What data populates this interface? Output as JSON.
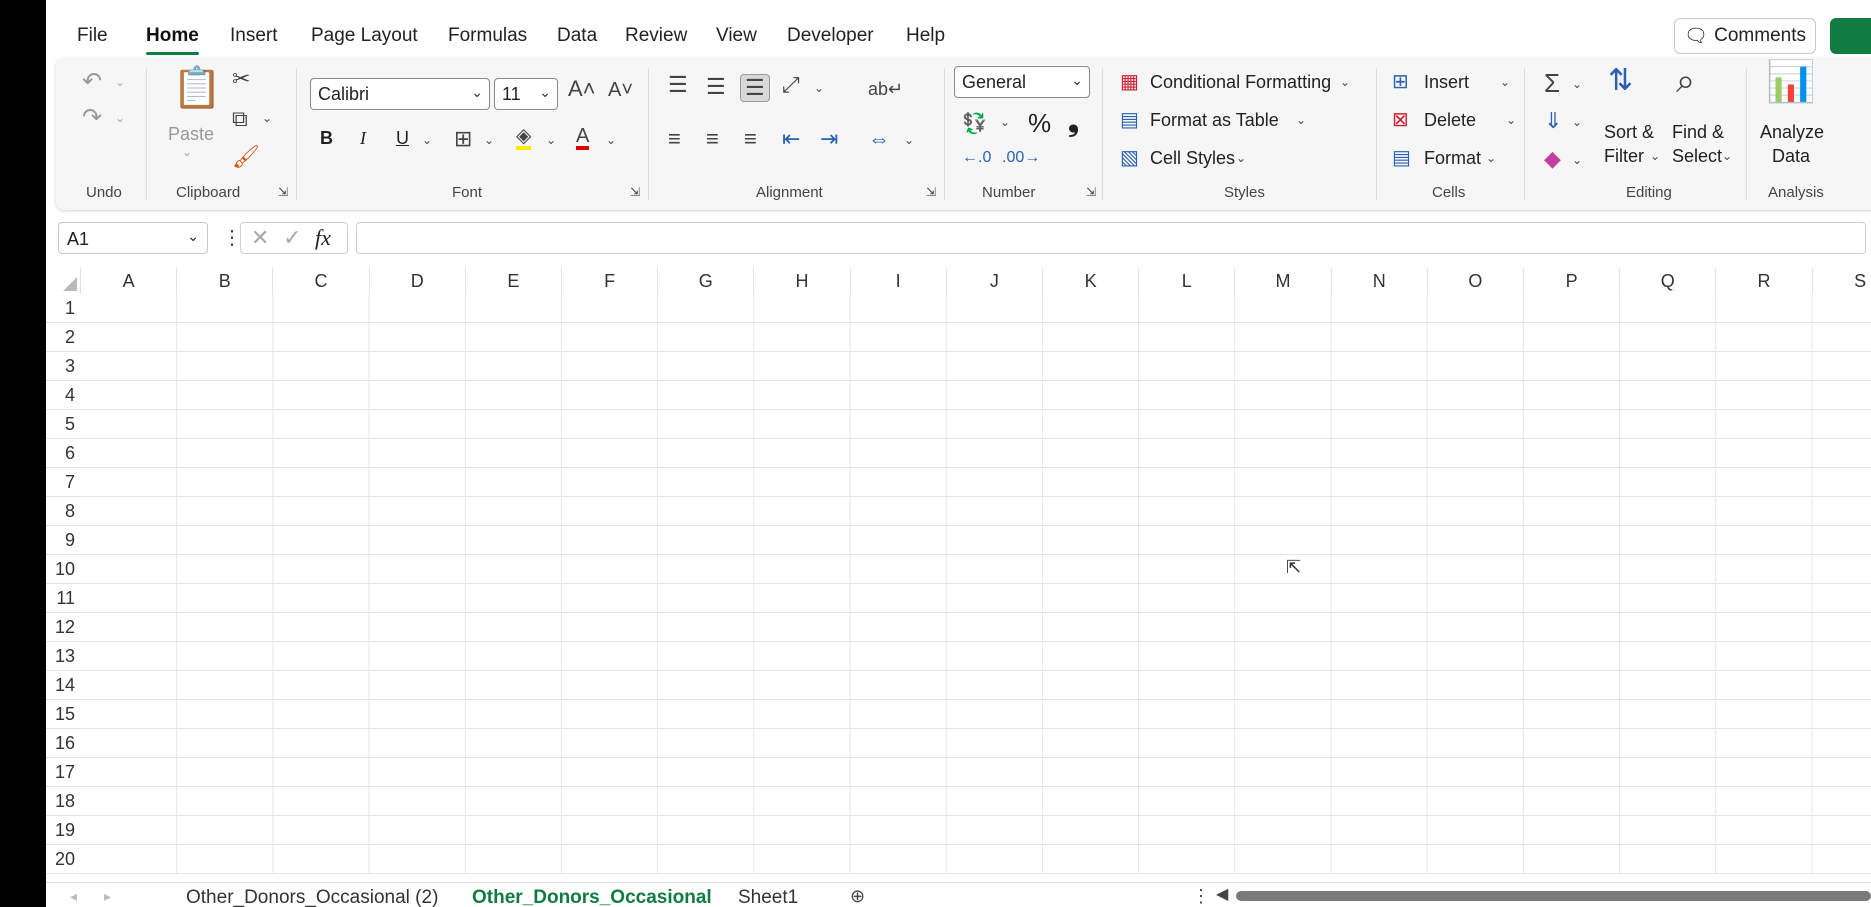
{
  "ribbon_tabs": [
    "File",
    "Home",
    "Insert",
    "Page Layout",
    "Formulas",
    "Data",
    "Review",
    "View",
    "Developer",
    "Help"
  ],
  "active_tab": "Home",
  "comments_label": "Comments",
  "groups": {
    "undo": "Undo",
    "clipboard": "Clipboard",
    "font": "Font",
    "alignment": "Alignment",
    "number": "Number",
    "styles": "Styles",
    "cells": "Cells",
    "editing": "Editing",
    "analysis": "Analysis"
  },
  "clipboard": {
    "paste": "Paste"
  },
  "font": {
    "name": "Calibri",
    "size": "11",
    "bold": "B",
    "italic": "I",
    "underline": "U"
  },
  "number": {
    "format": "General",
    "percent": "%",
    "comma": "❟"
  },
  "styles": {
    "conditional": "Conditional Formatting",
    "table": "Format as Table",
    "cell_styles": "Cell Styles"
  },
  "cells": {
    "insert": "Insert",
    "delete": "Delete",
    "format": "Format"
  },
  "editing": {
    "sort1": "Sort &",
    "sort2": "Filter",
    "find1": "Find &",
    "find2": "Select"
  },
  "analysis": {
    "l1": "Analyze",
    "l2": "Data"
  },
  "formula_bar": {
    "name_box": "A1",
    "fx": "fx",
    "value": ""
  },
  "columns": [
    "A",
    "B",
    "C",
    "D",
    "E",
    "F",
    "G",
    "H",
    "I",
    "J",
    "K",
    "L",
    "M",
    "N",
    "O",
    "P",
    "Q",
    "R",
    "S"
  ],
  "rows": [
    "1",
    "2",
    "3",
    "4",
    "5",
    "6",
    "7",
    "8",
    "9",
    "10",
    "11",
    "12",
    "13",
    "14",
    "15",
    "16",
    "17",
    "18",
    "19",
    "20"
  ],
  "sheets": [
    "Other_Donors_Occasional (2)",
    "Other_Donors_Occasional",
    "Sheet1"
  ],
  "active_sheet": "Other_Donors_Occasional",
  "colors": {
    "accent": "#107c41"
  }
}
